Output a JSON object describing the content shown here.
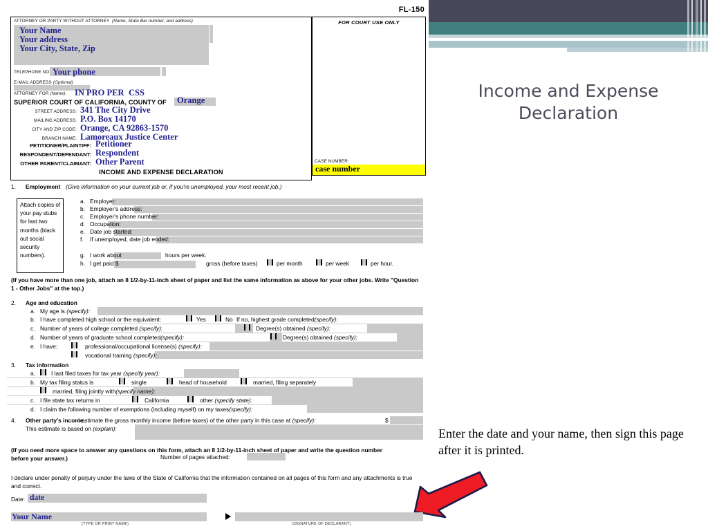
{
  "slide": {
    "title": "Income and Expense Declaration",
    "note": "Enter the date and your name, then sign this page after it is printed.",
    "accent_navy": "#464859",
    "accent_teal": "#3f7f80",
    "accent_lightblue": "#a8c4c9",
    "arrow_color": "#ee1c25",
    "arrow_outline": "#1b1b4b"
  },
  "form": {
    "form_number": "FL-150",
    "attorney_box": {
      "header_label": "ATTORNEY OR PARTY WITHOUT ATTORNEY",
      "header_hint": "(Name, State Bar number, and address)",
      "name": "Your Name",
      "address": "Your address",
      "city_state_zip": "Your City, State, Zip",
      "telephone_label": "TELEPHONE NO:",
      "telephone_value": "Your phone",
      "email_label": "E-MAIL ADDRESS",
      "email_hint": "(Optional)",
      "attorney_for_label": "ATTORNEY FOR",
      "attorney_for_hint": "(Name):",
      "attorney_for_value": "IN PRO PER",
      "attorney_for_value2": "CSS"
    },
    "court_block": {
      "court_label": "SUPERIOR COURT OF CALIFORNIA, COUNTY OF",
      "county": "Orange",
      "street_label": "STREET ADDRESS:",
      "street_value": "341 The City Drive",
      "mailing_label": "MAILING ADDRESS:",
      "mailing_value": "P.O. Box 14170",
      "city_zip_label": "CITY AND ZIP CODE:",
      "city_zip_value": "Orange, CA 92863-1570",
      "branch_label": "BRANCH NAME:",
      "branch_value": "Lamoreaux Justice Center"
    },
    "parties": {
      "petitioner_label": "PETITIONER/PLAINTIFF:",
      "petitioner_value": "Petitioner",
      "respondent_label": "RESPONDENT/DEFENDANT:",
      "respondent_value": "Respondent",
      "other_label": "OTHER PARENT/CLAIMANT:",
      "other_value": "Other Parent"
    },
    "court_use_only": "FOR COURT USE ONLY",
    "case_number_label": "CASE NUMBER:",
    "case_number_value": "case number",
    "case_number_highlight": "#ffff00",
    "form_title": "INCOME AND EXPENSE DECLARATION",
    "attach_note": "Attach copies of your pay stubs for last two months (black out social security numbers).",
    "section1": {
      "number": "1.",
      "heading": "Employment",
      "hint": "(Give information on your current job or, if you're unemployed, your most recent job.)",
      "items": [
        {
          "letter": "a.",
          "text": "Employer:"
        },
        {
          "letter": "b.",
          "text": "Employer's address:"
        },
        {
          "letter": "c.",
          "text": "Employer's phone number:"
        },
        {
          "letter": "d.",
          "text": "Occupation:"
        },
        {
          "letter": "e.",
          "text": "Date job started:"
        },
        {
          "letter": "f.",
          "text": "If unemployed, date job ended:"
        },
        {
          "letter": "g.",
          "text": "I work about",
          "text2": "hours per week."
        },
        {
          "letter": "h.",
          "text": "I get paid $",
          "text2": "gross (before taxes)"
        }
      ],
      "pay_options": [
        "per month",
        "per week",
        "per hour."
      ]
    },
    "note1": "(If you have more than one job, attach an 8 1/2-by-11-inch sheet of paper and list the same information as above for your other jobs. Write \"Question 1 - Other Jobs\" at the top.)",
    "section2": {
      "number": "2.",
      "heading": "Age and education",
      "a": {
        "letter": "a.",
        "text": "My age is",
        "hint": "(specify):"
      },
      "b": {
        "letter": "b.",
        "text": "I have completed high school or the equivalent:",
        "yes": "Yes",
        "no": "No",
        "tail": "If no, highest grade completed",
        "hint": "(specify):"
      },
      "c": {
        "letter": "c.",
        "text": "Number of years of college completed",
        "hint": "(specify):",
        "tail": "Degree(s) obtained",
        "tail_hint": "(specify):"
      },
      "d": {
        "letter": "d.",
        "text": "Number of years of graduate school completed",
        "hint": "(specify):",
        "tail": "Degree(s) obtained",
        "tail_hint": "(specify):"
      },
      "e": {
        "letter": "e.",
        "text": "I have:",
        "opt1": "professional/occupational license(s)",
        "opt1_hint": "(specify):",
        "opt2": "vocational training",
        "opt2_hint": "(specify):"
      }
    },
    "section3": {
      "number": "3.",
      "heading": "Tax information",
      "a": {
        "letter": "a.",
        "text": "I last filed taxes for tax year",
        "hint": "(specify year):"
      },
      "b": {
        "letter": "b.",
        "text": "My tax filing status is",
        "opt1": "single",
        "opt2": "head of household",
        "opt3": "married, filing separately",
        "opt4": "married, filing jointly with",
        "opt4_hint": "(specify name):"
      },
      "c": {
        "letter": "c.",
        "text": "I file state tax returns in",
        "opt1": "California",
        "opt2": "other",
        "opt2_hint": "(specify state):"
      },
      "d": {
        "letter": "d.",
        "text": "I claim the following number of exemptions (including myself) on my taxes",
        "hint": "(specify):"
      }
    },
    "section4": {
      "number": "4.",
      "heading": "Other party's income.",
      "text": "I estimate the gross monthly income (before taxes) of the other party in this case at",
      "hint": "(specify):",
      "dollar": "$",
      "line2": "This estimate is based on",
      "line2_hint": "(explain):"
    },
    "note2": "(If you need more space to answer any questions on this form, attach an 8 1/2-by-11-inch sheet of paper and write the question number before your answer.)",
    "pages_attached_label": "Number of pages attached:",
    "declaration": "I declare under penalty of perjury under the laws of the State of California that the information contained on all pages of this form and any attachments is true and correct.",
    "date_label": "Date:",
    "date_value": "date",
    "signer_name": "Your Name",
    "type_or_print_caption": "(TYPE OR PRINT NAME)",
    "signature_caption": "(SIGNATURE OF DECLARANT)"
  }
}
